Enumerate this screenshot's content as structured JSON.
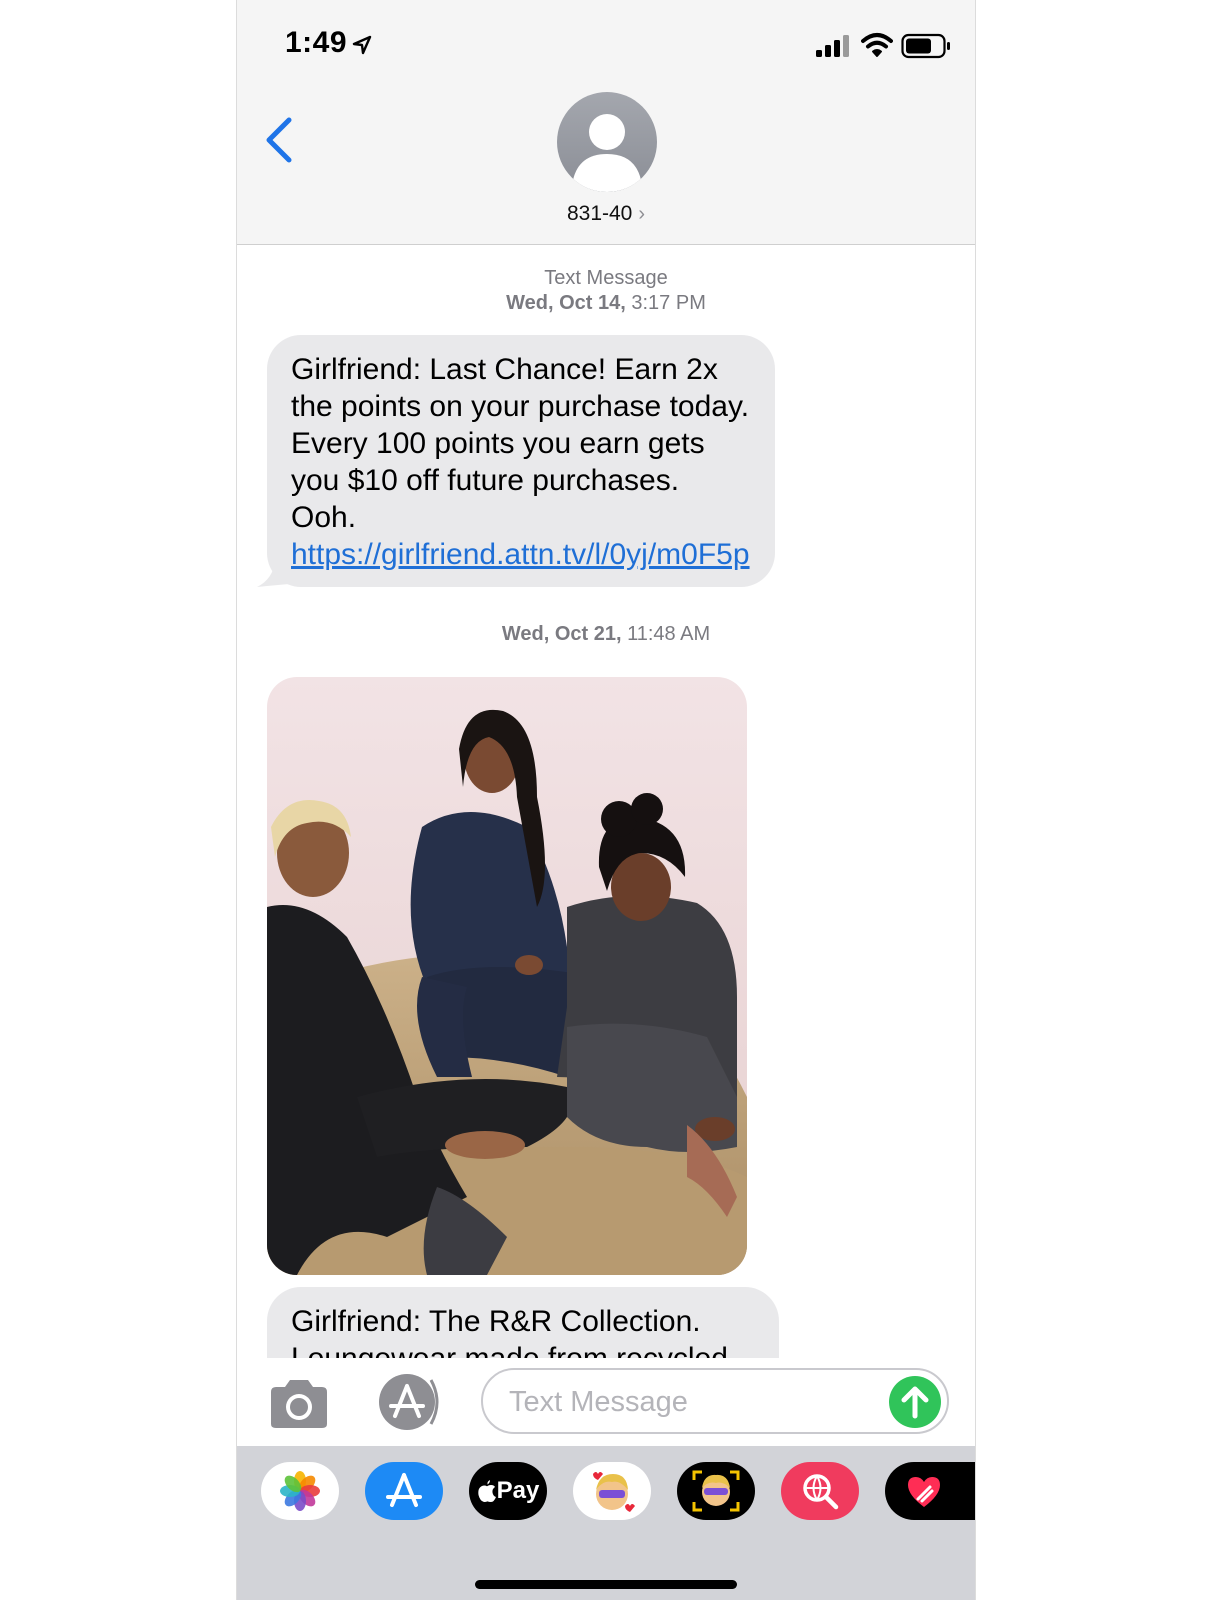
{
  "status_bar": {
    "time": "1:49"
  },
  "header": {
    "contact": "831-40",
    "contact_chevron": "›"
  },
  "thread": {
    "messages": [
      {
        "label": "Text Message",
        "timestamp_day": "Wed, Oct 14,",
        "timestamp_time": "3:17 PM",
        "text": "Girlfriend: Last Chance! Earn 2x the points on your purchase today. Every 100 points you earn gets you $10 off future purchases. Ooh. ",
        "link_text": "https://girlfriend.attn.tv/l/0yj/m0F5p"
      },
      {
        "timestamp_day": "Wed, Oct 21,",
        "timestamp_time": "11:48 AM",
        "text": "Girlfriend: The R&R Collection. Loungewear made from recycled"
      }
    ]
  },
  "input": {
    "placeholder": "Text Message"
  },
  "app_drawer": {
    "apps": [
      {
        "name": "photos-icon"
      },
      {
        "name": "app-store-icon"
      },
      {
        "name": "apple-pay-icon",
        "label": "Pay"
      },
      {
        "name": "memoji-stickers-icon"
      },
      {
        "name": "animoji-icon"
      },
      {
        "name": "web-search-icon"
      },
      {
        "name": "digital-touch-icon"
      }
    ]
  },
  "colors": {
    "link": "#1f6fd6",
    "send": "#30c45a",
    "back": "#1f74e8",
    "bubble": "#e9e9eb"
  }
}
